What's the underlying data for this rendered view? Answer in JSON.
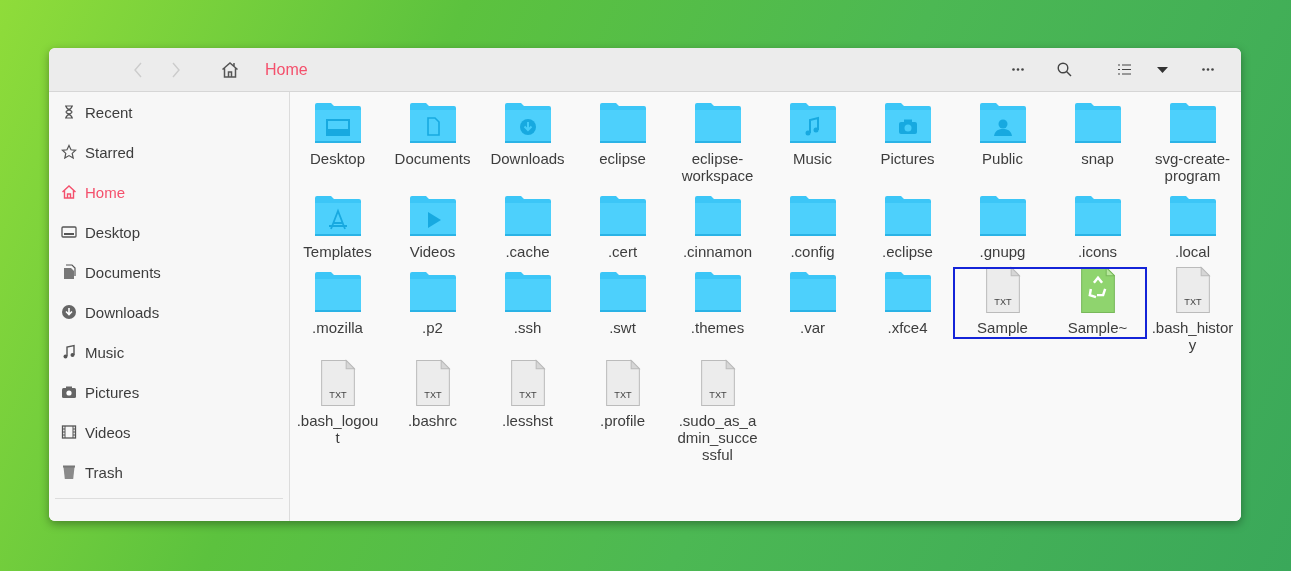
{
  "header": {
    "back": {
      "disabled": true
    },
    "forward": {
      "disabled": true
    },
    "location": "Home"
  },
  "sidebar": {
    "items": [
      {
        "label": "Recent",
        "selected": false
      },
      {
        "label": "Starred",
        "selected": false
      },
      {
        "label": "Home",
        "selected": true
      },
      {
        "label": "Desktop",
        "selected": false
      },
      {
        "label": "Documents",
        "selected": false
      },
      {
        "label": "Downloads",
        "selected": false
      },
      {
        "label": "Music",
        "selected": false
      },
      {
        "label": "Pictures",
        "selected": false
      },
      {
        "label": "Videos",
        "selected": false
      },
      {
        "label": "Trash",
        "selected": false
      }
    ]
  },
  "files": [
    {
      "name": "Desktop",
      "kind": "folder"
    },
    {
      "name": "Documents",
      "kind": "folder"
    },
    {
      "name": "Downloads",
      "kind": "folder"
    },
    {
      "name": "eclipse",
      "kind": "folder"
    },
    {
      "name": "eclipse-workspace",
      "kind": "folder"
    },
    {
      "name": "Music",
      "kind": "folder"
    },
    {
      "name": "Pictures",
      "kind": "folder"
    },
    {
      "name": "Public",
      "kind": "folder"
    },
    {
      "name": "snap",
      "kind": "folder"
    },
    {
      "name": "svg-create-program",
      "kind": "folder"
    },
    {
      "name": "Templates",
      "kind": "folder"
    },
    {
      "name": "Videos",
      "kind": "folder"
    },
    {
      "name": ".cache",
      "kind": "folder"
    },
    {
      "name": ".cert",
      "kind": "folder"
    },
    {
      "name": ".cinnamon",
      "kind": "folder"
    },
    {
      "name": ".config",
      "kind": "folder"
    },
    {
      "name": ".eclipse",
      "kind": "folder"
    },
    {
      "name": ".gnupg",
      "kind": "folder"
    },
    {
      "name": ".icons",
      "kind": "folder"
    },
    {
      "name": ".local",
      "kind": "folder"
    },
    {
      "name": ".mozilla",
      "kind": "folder"
    },
    {
      "name": ".p2",
      "kind": "folder"
    },
    {
      "name": ".ssh",
      "kind": "folder"
    },
    {
      "name": ".swt",
      "kind": "folder"
    },
    {
      "name": ".themes",
      "kind": "folder"
    },
    {
      "name": ".var",
      "kind": "folder"
    },
    {
      "name": ".xfce4",
      "kind": "folder"
    },
    {
      "name": "Sample",
      "kind": "text-file",
      "badge": "TXT",
      "highlighted": true
    },
    {
      "name": "Sample~",
      "kind": "backup-file",
      "highlighted": true
    },
    {
      "name": ".bash_history",
      "kind": "text-file",
      "badge": "TXT",
      "highlighted": false
    },
    {
      "name": ".bash_logout",
      "kind": "text-file",
      "badge": "TXT",
      "highlighted": false
    },
    {
      "name": ".bashrc",
      "kind": "text-file",
      "badge": "TXT",
      "highlighted": false
    },
    {
      "name": ".lesshst",
      "kind": "text-file",
      "badge": "TXT",
      "highlighted": false
    },
    {
      "name": ".profile",
      "kind": "text-file",
      "badge": "TXT",
      "highlighted": false
    },
    {
      "name": ".sudo_as_admin_successful",
      "kind": "text-file",
      "badge": "TXT",
      "highlighted": false
    }
  ]
}
